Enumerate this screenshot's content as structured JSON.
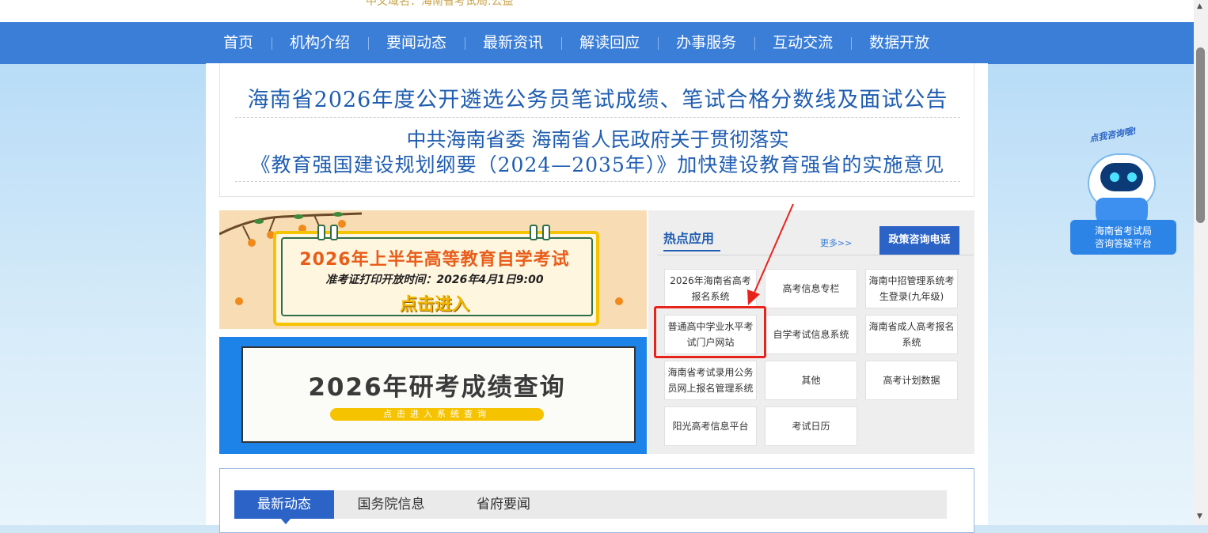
{
  "top_strip": {
    "text": "中文域名：海南省考试局.公益"
  },
  "nav": {
    "items": [
      "首页",
      "机构介绍",
      "要闻动态",
      "最新资讯",
      "解读回应",
      "办事服务",
      "互动交流",
      "数据开放"
    ]
  },
  "headlines": {
    "line1": "海南省2026年度公开遴选公务员笔试成绩、笔试合格分数线及面试公告",
    "line2a": "中共海南省委 海南省人民政府关于贯彻落实",
    "line2b": "《教育强国建设规划纲要（2024—2035年）》加快建设教育强省的实施意见"
  },
  "banner1": {
    "title": "2026年上半年高等教育自学考试",
    "sub": "准考证打印开放时间：2026年4月1日9:00",
    "enter": "点击进入"
  },
  "banner2": {
    "title": "2026年研考成绩查询",
    "sub": "点击进入系统查询"
  },
  "hot": {
    "title": "热点应用",
    "more": "更多>>",
    "phone": "政策咨询电话",
    "buttons": {
      "b1": "2026年海南省高考报名系统",
      "b2": "高考信息专栏",
      "b3": "海南中招管理系统考生登录(九年级)",
      "b4": "普通高中学业水平考试门户网站",
      "b5": "自学考试信息系统",
      "b6": "海南省成人高考报名系统",
      "b7": "海南省考试录用公务员网上报名管理系统",
      "b8": "其他",
      "b9": "高考计划数据",
      "b10": "阳光高考信息平台",
      "b11": "考试日历"
    }
  },
  "tabs": {
    "t1": "最新动态",
    "t2": "国务院信息",
    "t3": "省府要闻"
  },
  "robot": {
    "bubble": "点我咨询哦!",
    "plate_line1": "海南省考试局",
    "plate_line2": "咨询答疑平台"
  },
  "colors": {
    "nav": "#3a7ed8",
    "headline": "#1f5db0",
    "highlight": "#e8231b",
    "accent": "#2b63c6"
  }
}
